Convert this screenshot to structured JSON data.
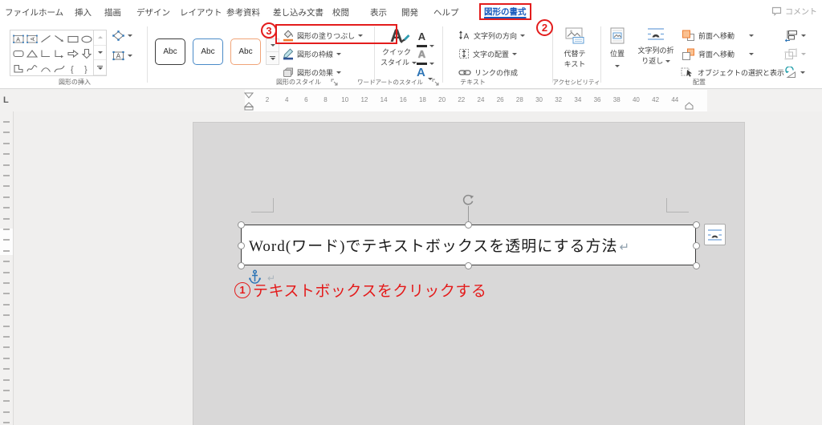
{
  "menu": {
    "items": [
      "ファイル",
      "ホーム",
      "挿入",
      "描画",
      "デザイン",
      "レイアウト",
      "参考資料",
      "差し込み文書",
      "校閲",
      "表示",
      "開発",
      "ヘルプ",
      "図形の書式"
    ],
    "active": "図形の書式"
  },
  "window": {
    "comment_label": "コメント"
  },
  "callouts": {
    "one": "1",
    "two": "2",
    "three": "3",
    "step1_text": "テキストボックスをクリックする"
  },
  "ribbon": {
    "insert_shapes": {
      "label": "図形の挿入",
      "gallery_icons": [
        "text-box",
        "vertical-text-box",
        "line",
        "arrow",
        "rectangle",
        "oval",
        "rounded-rectangle",
        "triangle",
        "elbow-connector",
        "elbow-arrow",
        "right-block-arrow",
        "down-block-arrow",
        "corner-shape",
        "scribble",
        "arc",
        "curve",
        "left-brace",
        "right-brace"
      ]
    },
    "shape_styles": {
      "label": "図形のスタイル",
      "style_samples": [
        "Abc",
        "Abc",
        "Abc"
      ],
      "fill_label": "図形の塗りつぶし",
      "outline_label": "図形の枠線",
      "effects_label": "図形の効果"
    },
    "wordart": {
      "label": "ワードアートのスタイル",
      "quick_line1": "クイック",
      "quick_line2": "スタイル",
      "letter": "A"
    },
    "text_group": {
      "label": "テキスト",
      "direction_label": "文字列の方向",
      "align_label": "文字の配置",
      "link_label": "リンクの作成"
    },
    "accessibility": {
      "label": "アクセシビリティ",
      "alt_line1": "代替テ",
      "alt_line2": "キスト"
    },
    "arrange": {
      "label": "配置",
      "position_label": "位置",
      "wrap_line1": "文字列の折",
      "wrap_line2": "り返し",
      "front_label": "前面へ移動",
      "back_label": "背面へ移動",
      "selection_label": "オブジェクトの選択と表示"
    }
  },
  "ruler": {
    "numbers": [
      2,
      4,
      6,
      8,
      10,
      12,
      14,
      16,
      18,
      20,
      22,
      24,
      26,
      28,
      30,
      32,
      34,
      36,
      38,
      40,
      42,
      44
    ],
    "tab_selector": "L"
  },
  "document": {
    "textbox_text": "Word(ワード)でテキストボックスを透明にする方法",
    "paragraph_mark": "↵"
  },
  "colors": {
    "annotation_red": "#e31c1c",
    "active_tab_blue": "#185abd",
    "fill_orange": "#ed7d31",
    "outline_navy": "#2f5496",
    "anchor_blue": "#2e75b6"
  }
}
